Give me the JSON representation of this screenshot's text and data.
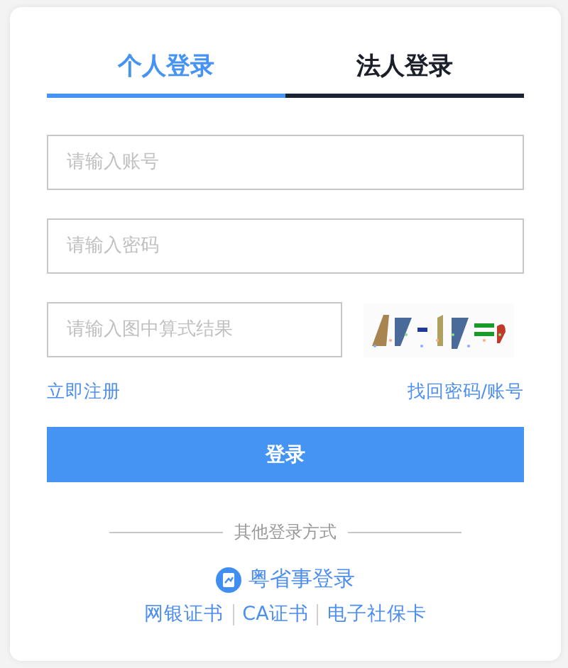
{
  "tabs": [
    {
      "label": "个人登录",
      "selected": true
    },
    {
      "label": "法人登录",
      "selected": false
    }
  ],
  "fields": [
    {
      "placeholder": "请输入账号"
    },
    {
      "placeholder": "请输入密码"
    }
  ],
  "captcha": {
    "placeholder": "请输入图中算式结果"
  },
  "links": {
    "register": "立即注册",
    "recover": "找回密码/账号"
  },
  "login_button": "登录",
  "other_login": {
    "title": "其他登录方式",
    "app_login": "粤省事登录",
    "methods": [
      "网银证书",
      "CA证书",
      "电子社保卡"
    ]
  }
}
